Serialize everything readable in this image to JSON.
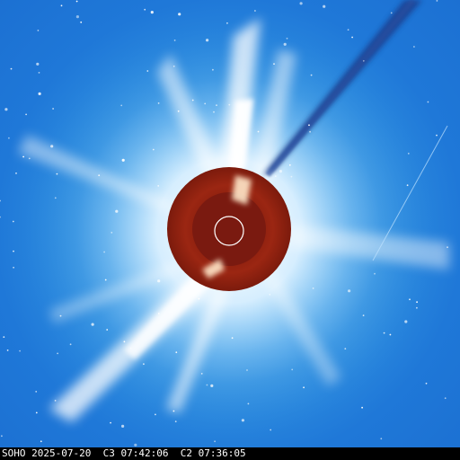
{
  "image": {
    "observatory": "SOHO",
    "date": "2025-07-20",
    "c3_label": "C3",
    "c3_time": "07:42:06",
    "c2_label": "C2",
    "c2_time": "07:36:05"
  },
  "colors": {
    "background": "#1f78d8",
    "corona": "#ffffff",
    "occulter": "#8c1a0c",
    "occulter_inner": "#7a1a10",
    "sun_circle": "#ffffff",
    "comet_tail": "#1b3f8f",
    "footer_bg": "#000000",
    "footer_text": "#ffffff"
  }
}
